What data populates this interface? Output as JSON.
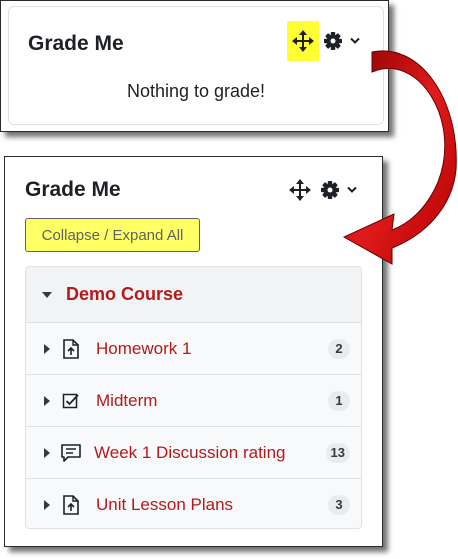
{
  "colors": {
    "highlight": "#ffff33",
    "link": "#b51a1a",
    "arrow": "#c00000"
  },
  "before_block": {
    "title": "Grade Me",
    "empty_message": "Nothing to grade!"
  },
  "after_block": {
    "title": "Grade Me",
    "collapse_button": "Collapse / Expand All",
    "course": {
      "name": "Demo Course",
      "items": [
        {
          "label": "Homework 1",
          "count": "2",
          "icon": "assignment-upload-icon"
        },
        {
          "label": "Midterm",
          "count": "1",
          "icon": "quiz-checkbox-icon"
        },
        {
          "label": "Week 1 Discussion rating",
          "count": "13",
          "icon": "forum-chat-icon"
        },
        {
          "label": "Unit Lesson Plans",
          "count": "3",
          "icon": "assignment-upload-icon"
        }
      ]
    }
  }
}
